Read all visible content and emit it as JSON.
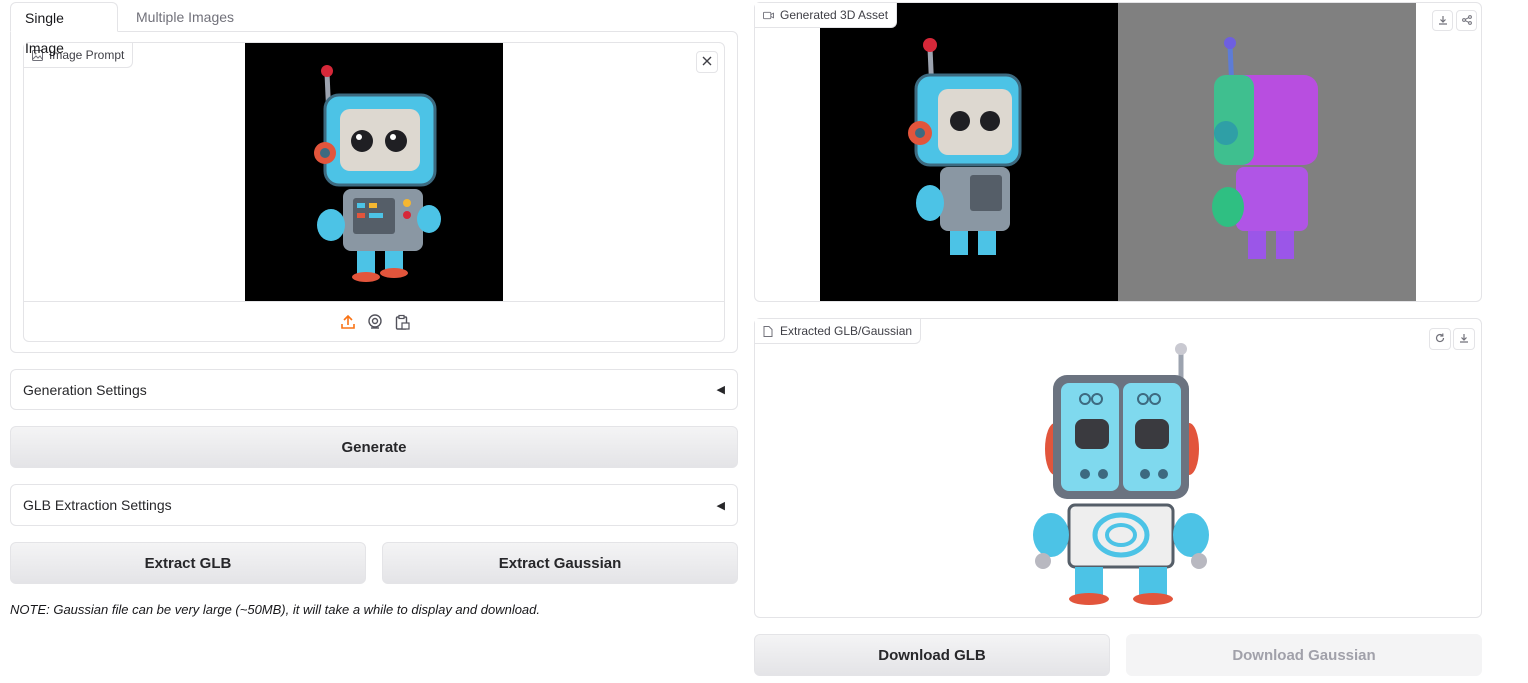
{
  "tabs": {
    "single": "Single Image",
    "multiple": "Multiple Images"
  },
  "image_prompt": {
    "label": "Image Prompt"
  },
  "generation_settings": {
    "label": "Generation Settings"
  },
  "generate_button": "Generate",
  "glb_settings": {
    "label": "GLB Extraction Settings"
  },
  "extract_glb_button": "Extract GLB",
  "extract_gaussian_button": "Extract Gaussian",
  "note": "NOTE: Gaussian file can be very large (~50MB), it will take a while to display and download.",
  "generated_asset": {
    "label": "Generated 3D Asset"
  },
  "extracted_asset": {
    "label": "Extracted GLB/Gaussian"
  },
  "download_glb_button": "Download GLB",
  "download_gaussian_button": "Download Gaussian",
  "colors": {
    "accent": "#f97316",
    "robot_blue": "#4cc3e6",
    "normal_map_bg": "#808080"
  }
}
